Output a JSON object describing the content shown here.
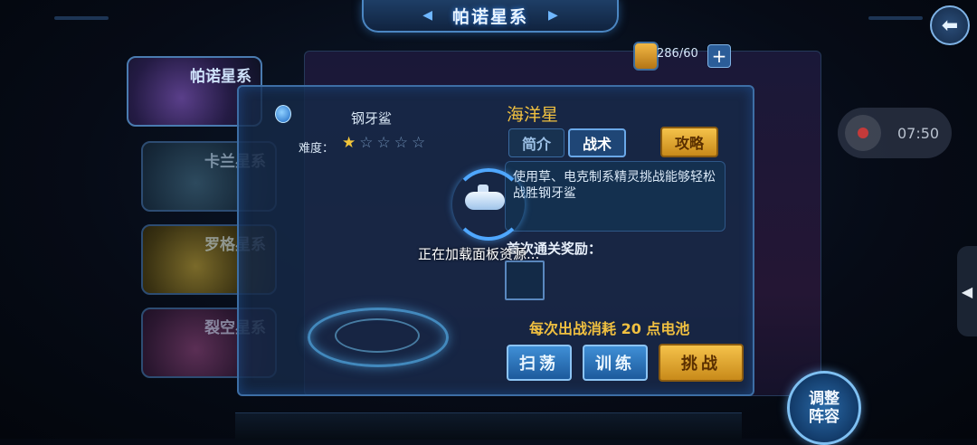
{
  "header": {
    "title": "帕诺星系"
  },
  "battery": {
    "value": "286/60",
    "add_label": "+"
  },
  "record": {
    "time": "07:50"
  },
  "galaxies": [
    {
      "label": "帕诺星系"
    },
    {
      "label": "卡兰星系"
    },
    {
      "label": "罗格星系"
    },
    {
      "label": "裂空星系"
    }
  ],
  "dialog": {
    "boss_name": "钢牙鲨",
    "difficulty_label": "难度：",
    "difficulty": {
      "filled": 1,
      "total": 5
    },
    "planet_name": "海洋星",
    "tabs": {
      "intro": "简介",
      "tactic": "战术",
      "guide": "攻略"
    },
    "description": "使用草、电克制系精灵挑战能够轻松战胜钢牙鲨",
    "reward_label": "首次通关奖励：",
    "cost_text": "每次出战消耗 20 点电池",
    "buttons": {
      "sweep": "扫荡",
      "train": "训练",
      "challenge": "挑战"
    }
  },
  "loading": {
    "text": "正在加载面板资源..."
  },
  "formation": {
    "label": "调整阵容"
  },
  "colors": {
    "accent_gold": "#f0c040",
    "panel_blue": "#3d6ea5"
  }
}
